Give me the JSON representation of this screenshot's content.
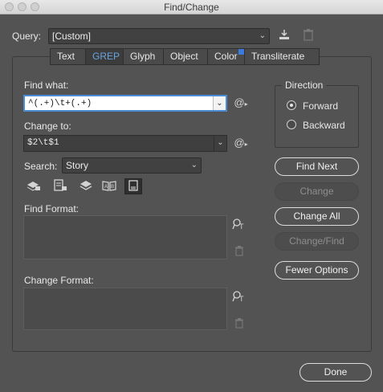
{
  "window": {
    "title": "Find/Change"
  },
  "query": {
    "label": "Query:",
    "value": "[Custom]"
  },
  "tabs": [
    {
      "label": "Text"
    },
    {
      "label": "GREP"
    },
    {
      "label": "Glyph"
    },
    {
      "label": "Object"
    },
    {
      "label": "Color"
    },
    {
      "label": "Transliterate"
    }
  ],
  "find_what": {
    "label": "Find what:",
    "value": "^(.+)\\t+(.+)"
  },
  "change_to": {
    "label": "Change to:",
    "value": "$2\\t$1"
  },
  "search": {
    "label": "Search:",
    "value": "Story"
  },
  "find_format": {
    "label": "Find Format:"
  },
  "change_format": {
    "label": "Change Format:"
  },
  "direction": {
    "title": "Direction",
    "options": [
      {
        "label": "Forward",
        "selected": true
      },
      {
        "label": "Backward",
        "selected": false
      }
    ]
  },
  "buttons": {
    "find_next": "Find Next",
    "change": "Change",
    "change_all": "Change All",
    "change_find": "Change/Find",
    "fewer_options": "Fewer Options",
    "done": "Done"
  },
  "colors": {
    "accent": "#4a8bd6",
    "active_tab": "#6aa3e0",
    "background": "#535353"
  }
}
